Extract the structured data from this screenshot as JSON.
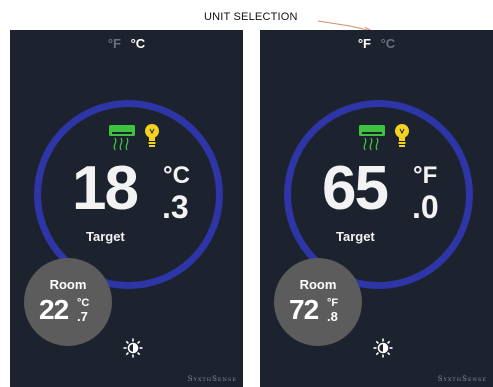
{
  "annotation": {
    "label": "UNIT SELECTION"
  },
  "colors": {
    "panel_bg": "#1c222e",
    "ring": "#2e35a6",
    "room_bubble": "#5c5c5c",
    "cooling_icon": "#3fc23f",
    "light_icon": "#f4d21e",
    "active_unit": "#ffffff",
    "inactive_unit": "#6a7080"
  },
  "panels": [
    {
      "units": [
        {
          "label": "°F",
          "selected": false
        },
        {
          "label": "°C",
          "selected": true
        }
      ],
      "mode_icons": [
        "air-conditioner-icon",
        "light-bulb-icon"
      ],
      "setpoint": {
        "whole": "18",
        "decimal": ".3",
        "unit": "°C",
        "label": "Target"
      },
      "room": {
        "label": "Room",
        "whole": "22",
        "decimal": ".7",
        "unit": "°C"
      },
      "settings_icon": "sun-icon",
      "brand": "SyxthSense"
    },
    {
      "units": [
        {
          "label": "°F",
          "selected": true
        },
        {
          "label": "°C",
          "selected": false
        }
      ],
      "mode_icons": [
        "air-conditioner-icon",
        "light-bulb-icon"
      ],
      "setpoint": {
        "whole": "65",
        "decimal": ".0",
        "unit": "°F",
        "label": "Target"
      },
      "room": {
        "label": "Room",
        "whole": "72",
        "decimal": ".8",
        "unit": "°F"
      },
      "settings_icon": "sun-icon",
      "brand": "SyxthSense"
    }
  ]
}
